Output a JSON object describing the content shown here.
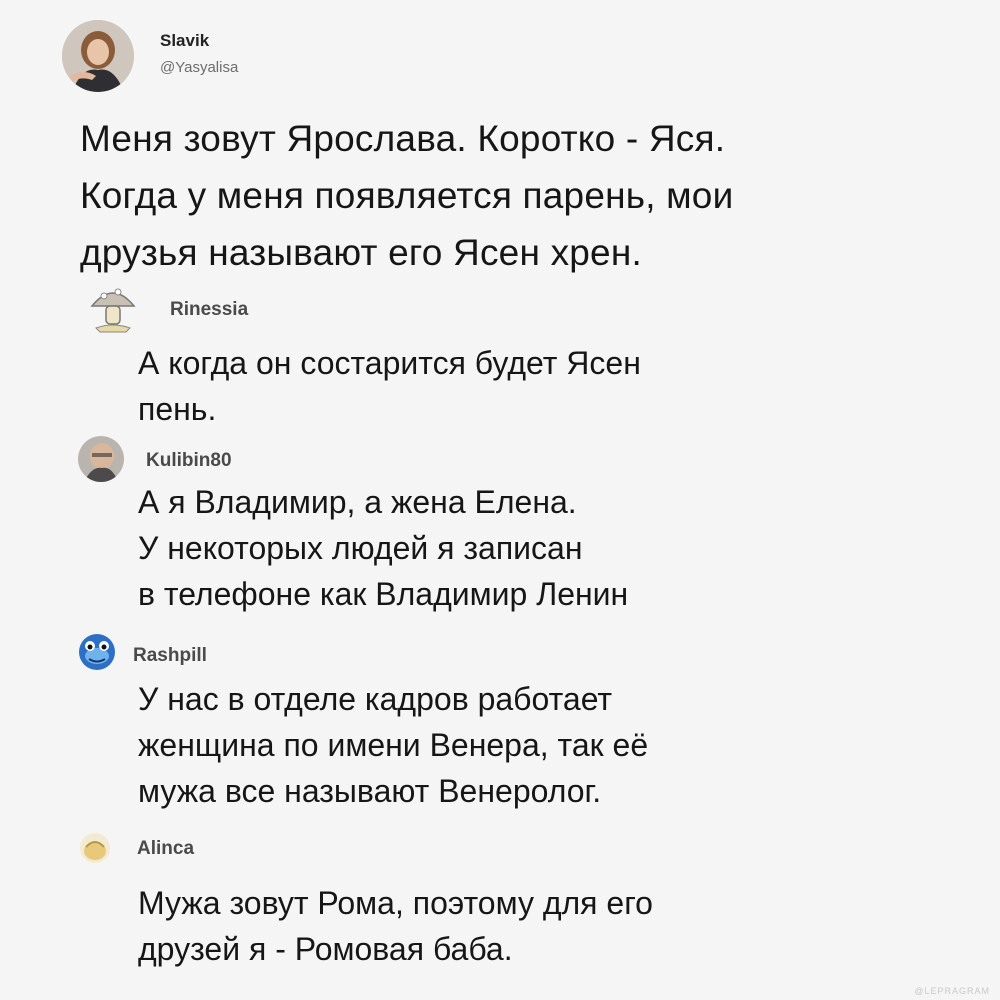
{
  "tweet": {
    "author_name": "Slavik",
    "author_handle": "@Yasyalisa",
    "lines": [
      "Меня зовут Ярослава. Коротко - Яся.",
      "Когда у меня появляется парень, мои",
      "друзья называют его Ясен хрен."
    ]
  },
  "comments": [
    {
      "author": "Rinessia",
      "lines": [
        "А когда он состарится будет Ясен",
        "пень."
      ]
    },
    {
      "author": "Kulibin80",
      "lines": [
        "А я Владимир, а жена Елена.",
        "У некоторых людей я записан",
        "в телефоне как Владимир Ленин"
      ]
    },
    {
      "author": "Rashpill",
      "lines": [
        "У нас в отделе кадров работает",
        "женщина по имени Венера, так её",
        "мужа все называют Венеролог."
      ]
    },
    {
      "author": "Alinca",
      "lines": [
        "Мужа зовут Рома, поэтому для его",
        "друзей я - Ромовая баба."
      ]
    }
  ],
  "watermark": "@LEPRAGRAM",
  "icons": {
    "tweet_avatar": "profile-photo",
    "rinessia_avatar": "mushroom-avatar",
    "kulibin_avatar": "profile-photo",
    "rashpill_avatar": "blue-creature-avatar",
    "alinca_avatar": "small-photo-avatar"
  }
}
